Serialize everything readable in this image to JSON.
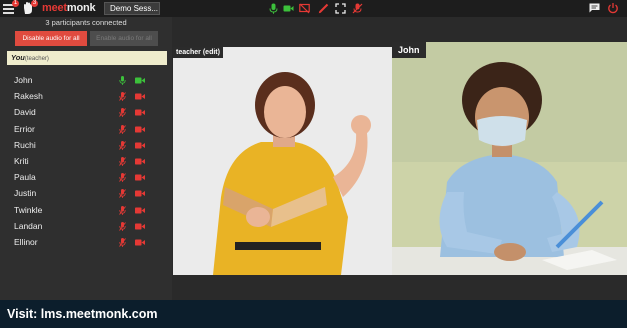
{
  "topbar": {
    "menu_badge": "1",
    "hand_badge": "3",
    "logo_part1": "meet",
    "logo_part2": "monk",
    "session_tab": "Demo Sess...",
    "controls": [
      "mic-icon",
      "camera-icon",
      "screen-share-off-icon",
      "pen-icon",
      "fullscreen-icon",
      "mute-all-icon"
    ],
    "colors": {
      "green": "#3cc13b",
      "red": "#e53935"
    }
  },
  "left_panel": {
    "participants_connected": "3 participants connected",
    "disable_audio_label": "Disable audio for all",
    "enable_audio_label": "Enable audio for all",
    "you_label": "You",
    "you_role": "(teacher)",
    "participants": [
      {
        "name": "John",
        "mic": "on",
        "camera": "on"
      },
      {
        "name": "Rakesh",
        "mic": "off",
        "camera": "off"
      },
      {
        "name": "David",
        "mic": "off",
        "camera": "off"
      },
      {
        "name": "Errior",
        "mic": "off",
        "camera": "off"
      },
      {
        "name": "Ruchi",
        "mic": "off",
        "camera": "off"
      },
      {
        "name": "Kriti",
        "mic": "off",
        "camera": "off"
      },
      {
        "name": "Paula",
        "mic": "off",
        "camera": "off"
      },
      {
        "name": "Justin",
        "mic": "off",
        "camera": "off"
      },
      {
        "name": "Twinkle",
        "mic": "off",
        "camera": "off"
      },
      {
        "name": "Landan",
        "mic": "off",
        "camera": "off"
      },
      {
        "name": "Ellinor",
        "mic": "off",
        "camera": "off"
      }
    ]
  },
  "video": {
    "teacher_label": "teacher (edit)",
    "student_label": "John"
  },
  "footer": {
    "text": "Visit: lms.meetmonk.com"
  }
}
